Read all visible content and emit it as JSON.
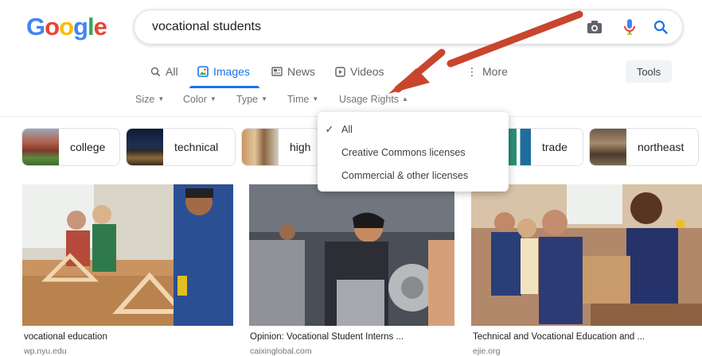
{
  "logo": [
    "G",
    "o",
    "o",
    "g",
    "l",
    "e"
  ],
  "logo_colors": [
    "#4285F4",
    "#EA4335",
    "#FBBC05",
    "#4285F4",
    "#34A853",
    "#EA4335"
  ],
  "search": {
    "query": "vocational students",
    "icons": [
      "camera-icon",
      "mic-icon",
      "search-icon"
    ]
  },
  "tabs": [
    {
      "label": "All",
      "icon": "search-icon"
    },
    {
      "label": "Images",
      "icon": "images-icon"
    },
    {
      "label": "News",
      "icon": "news-icon"
    },
    {
      "label": "Videos",
      "icon": "video-icon"
    },
    {
      "label": "More",
      "icon": "more-vert-icon"
    }
  ],
  "tools_label": "Tools",
  "filters": [
    "Size",
    "Color",
    "Type",
    "Time",
    "Usage Rights"
  ],
  "chips": [
    {
      "label": "college"
    },
    {
      "label": "technical"
    },
    {
      "label": "high"
    },
    {
      "label": "trade"
    },
    {
      "label": "northeast"
    }
  ],
  "usage_rights_menu": {
    "items": [
      "All",
      "Creative Commons licenses",
      "Commercial & other licenses"
    ],
    "selected": "All"
  },
  "results": [
    {
      "caption": "vocational education",
      "source": "wp.nyu.edu"
    },
    {
      "caption": "Opinion: Vocational Student Interns ...",
      "source": "caixinglobal.com"
    },
    {
      "caption": "Technical and Vocational Education and ...",
      "source": "ejie.org"
    }
  ],
  "colors": {
    "accent": "#1a73e8",
    "annotation_arrow": "#c8452e"
  }
}
